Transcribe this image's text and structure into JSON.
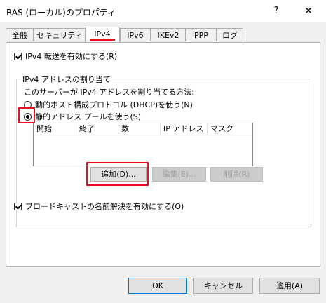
{
  "window": {
    "title": "RAS (ローカル)のプロパティ",
    "help_glyph": "?",
    "close_glyph": "✕"
  },
  "tabs": [
    {
      "label": "全般"
    },
    {
      "label": "セキュリティ"
    },
    {
      "label": "IPv4",
      "active": true
    },
    {
      "label": "IPv6"
    },
    {
      "label": "IKEv2"
    },
    {
      "label": "PPP"
    },
    {
      "label": "ログ"
    }
  ],
  "ipv4_forwarding": {
    "label": "IPv4 転送を有効にする(R)",
    "checked": true
  },
  "address_assignment": {
    "group_title": "IPv4 アドレスの割り当て",
    "method_prompt": "このサーバーが IPv4 アドレスを割り当てる方法:",
    "option_dhcp": "動的ホスト構成プロトコル (DHCP)を使う(N)",
    "option_static": "静的アドレス プールを使う(S)",
    "selected": "static",
    "columns": [
      "開始",
      "終了",
      "数",
      "IP アドレス",
      "マスク"
    ],
    "add_button": "追加(D)...",
    "edit_button": "編集(E)...",
    "delete_button": "削除(R)"
  },
  "broadcast_name_resolution": {
    "label": "ブロードキャストの名前解決を有効にする(O)",
    "checked": true
  },
  "footer": {
    "ok": "OK",
    "cancel": "キャンセル",
    "apply": "適用(A)"
  },
  "colors": {
    "highlight": "#e8101a",
    "focus": "#0078d7"
  }
}
